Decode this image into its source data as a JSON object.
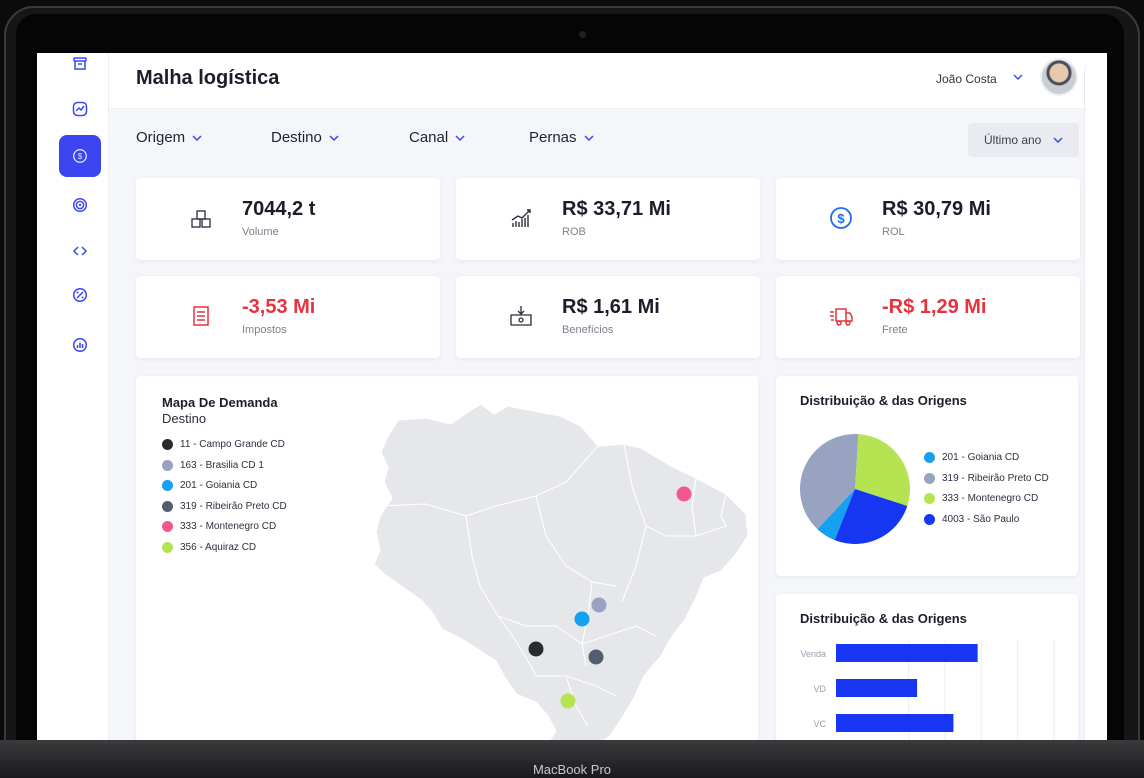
{
  "device": {
    "label": "MacBook Pro"
  },
  "sidebar": {
    "items": [
      {
        "icon": "archive-icon",
        "active": false
      },
      {
        "icon": "trend-chart-icon",
        "active": false
      },
      {
        "icon": "dollar-circle-icon",
        "active": true
      },
      {
        "icon": "target-icon",
        "active": false
      },
      {
        "icon": "code-icon",
        "active": false
      },
      {
        "icon": "percent-badge-icon",
        "active": false
      },
      {
        "icon": "bar-chart-icon",
        "active": false
      }
    ]
  },
  "header": {
    "title": "Malha logística",
    "user_name": "João Costa"
  },
  "filters": {
    "origem": "Origem",
    "destino": "Destino",
    "canal": "Canal",
    "pernas": "Pernas",
    "period": "Último ano"
  },
  "kpis": {
    "volume": {
      "value": "7044,2 t",
      "label": "Volume",
      "icon": "boxes-icon"
    },
    "rob": {
      "value": "R$ 33,71 Mi",
      "label": "ROB",
      "icon": "growth-bars-icon"
    },
    "rol": {
      "value": "R$ 30,79 Mi",
      "label": "ROL",
      "icon": "dollar-coin-icon"
    },
    "impostos": {
      "value": "-3,53 Mi",
      "label": "Impostos",
      "icon": "receipt-icon"
    },
    "beneficios": {
      "value": "R$ 1,61 Mi",
      "label": "Benefícios",
      "icon": "cash-drawer-icon"
    },
    "frete": {
      "value": "-R$ 1,29 Mi",
      "label": "Frete",
      "icon": "delivery-truck-icon"
    }
  },
  "colors": {
    "accent": "#3b46f1",
    "negative": "#e8323f",
    "series_dark": "#2a2b30",
    "series_gray": "#97a3c0",
    "series_cyan": "#16a0f0",
    "series_slate": "#525d6f",
    "series_pink": "#f0588e",
    "series_lime": "#b5e352",
    "series_blue": "#1636f2"
  },
  "map_panel": {
    "title": "Mapa De Demanda",
    "subtitle": "Destino",
    "legend": [
      {
        "label": "11 - Campo Grande CD",
        "color": "#2a2b30"
      },
      {
        "label": "163 - Brasilia CD 1",
        "color": "#97a3c0"
      },
      {
        "label": "201 - Goiania CD",
        "color": "#16a0f0"
      },
      {
        "label": "319 - Ribeirão Preto CD",
        "color": "#525d6f"
      },
      {
        "label": "333 - Montenegro CD",
        "color": "#f0588e"
      },
      {
        "label": "356 - Aquiraz CD",
        "color": "#b5e352"
      }
    ]
  },
  "pie_panel": {
    "title": "Distribuição & das Origens",
    "legend": [
      {
        "label": "201 - Goiania CD",
        "color": "#16a0f0"
      },
      {
        "label": "319 - Ribeirão Preto CD",
        "color": "#97a3c0"
      },
      {
        "label": "333 - Montenegro CD",
        "color": "#b5e352"
      },
      {
        "label": "4003 - São Paulo",
        "color": "#1636f2"
      }
    ]
  },
  "bar_panel": {
    "title": "Distribuição & das Origens"
  },
  "chart_data": [
    {
      "type": "pie",
      "title": "Distribuição & das Origens",
      "labels": [
        "201 - Goiania CD",
        "319 - Ribeirão Preto CD",
        "333 - Montenegro CD",
        "4003 - São Paulo"
      ],
      "values": [
        6,
        39,
        29,
        26
      ],
      "colors": [
        "#16a0f0",
        "#97a3c0",
        "#b5e352",
        "#1636f2"
      ]
    },
    {
      "type": "bar",
      "orientation": "horizontal",
      "title": "Distribuição & das Origens",
      "categories": [
        "Venda",
        "VD",
        "VC"
      ],
      "values": [
        117,
        67,
        97
      ],
      "xlim": [
        0,
        190
      ],
      "color": "#1636f2",
      "grid": true
    }
  ]
}
